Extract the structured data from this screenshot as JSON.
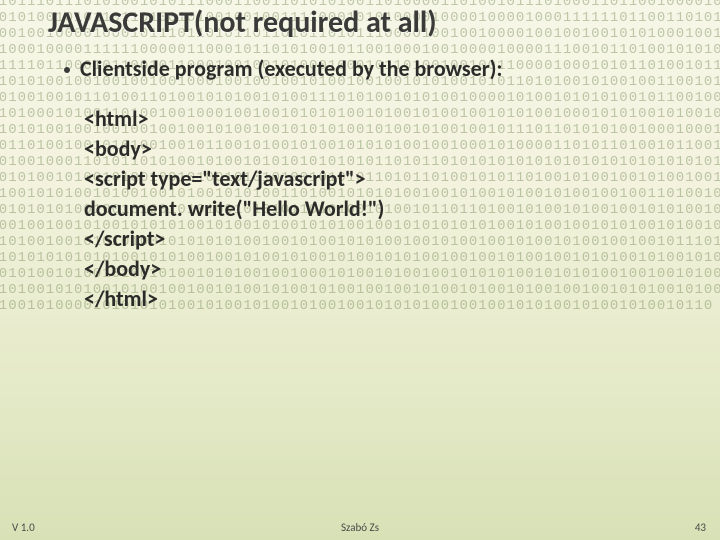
{
  "title": "JAVASCRIPT(not required at all)",
  "bullet": "Clientside program (executed by the browser):",
  "code": {
    "l1": "<html>",
    "l2": "<body>",
    "l3": "",
    "l4": "<script type=\"text/javascript\">",
    "l5": "document. write(\"Hello World!\")",
    "l6": "</script>",
    "l7": "",
    "l8": "</body>",
    "l9": "</html>"
  },
  "footer": {
    "version": "V 1.0",
    "author": "Szabó Zs",
    "page": "43"
  },
  "bg": {
    "binary": "1010111011101010010101110001100110101010011010000110100101110100011011001000010010100101001010110110100101001001001111000101010000100001000010001111110110011010101001001001000010001011101101011011010110101110000100100100001001001001010100010011000010001000011111100000110001011010100101100100010010000100001110010110100101010100111111011000101100101100010010010100010001011010010010011000010001010110100101101010101010010010010010010001001001001010010010010101001010110101001010010011001010101001001001011010011010010101001010011101010010101001000010100101010100101100100101001010001010011010010010001001001010101001010010100100101010010001010100101001010010101010010010010010010010100100101010100101001010010010111011010101001000100010110101101001001010100100101100101001010010101010010010001010000110101101001011001001010100100011010110101001010010101010101010110101101010101010101010101010101010101001010100101001010010010100101010100101010110101101001010110100101001001010010010101010010101001010010010100101010011010010101010010010100101001010010010011010010010010101010100100101001010100101010110101001010010110110100101001010010010101001010101001001001010010101010010100101001010100100101010101010010100100101010010100101010010100100101010100101010101001001010010101001001010010010100101001001001011101010101010101010101001010100100101001010010100101010010010010100100101010010100101001010010100101001010010100101010010010001010010100100101010100101010100100100101001010010100101010010100100100101001010010100100100101001010010100100100101010010100100101001010000101010101001010010100101001001010101001001001010100101001010010110"
  }
}
